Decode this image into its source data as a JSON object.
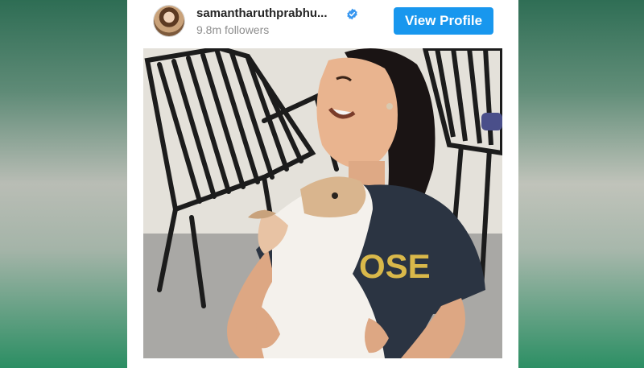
{
  "post": {
    "username": "samantharuthprabhu...",
    "followers": "9.8m followers",
    "verified": true,
    "verified_icon": "verified-badge-icon",
    "view_profile_label": "View Profile",
    "accent_color": "#1897ee",
    "shirt_text": "OSE"
  }
}
